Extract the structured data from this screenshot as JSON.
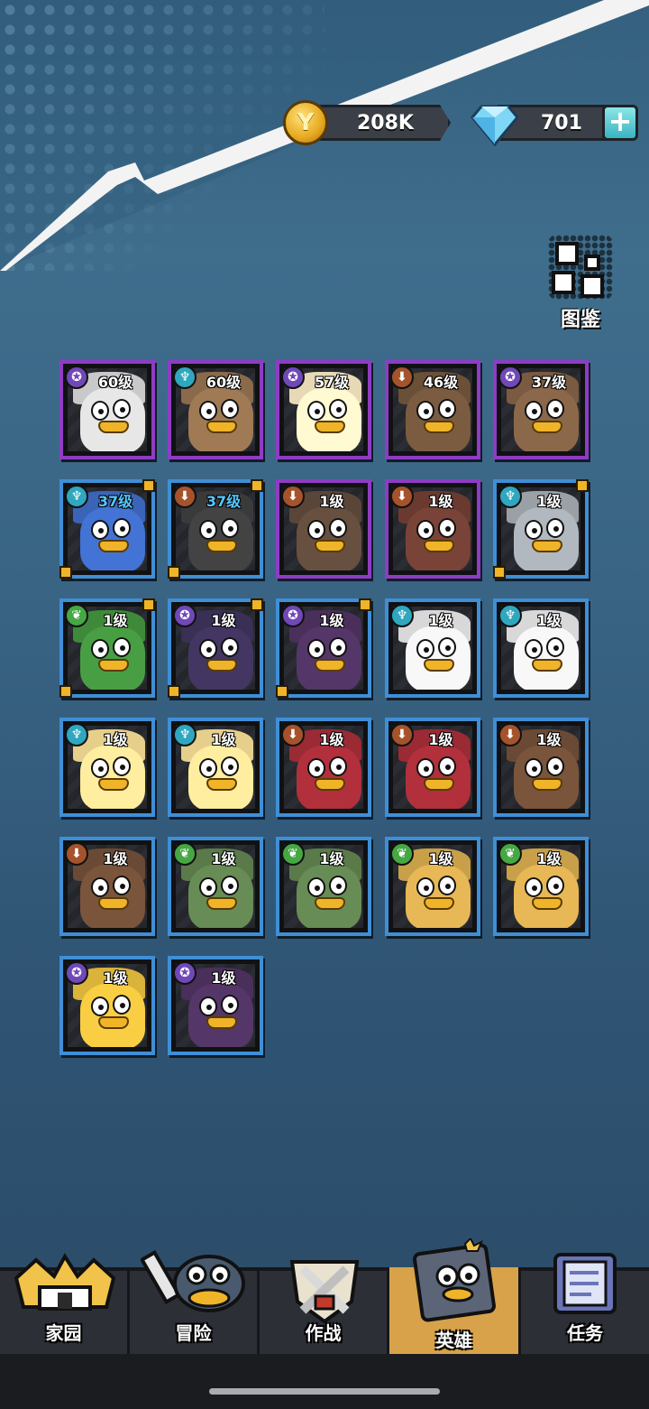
{
  "currency": {
    "coins": "208K",
    "gems": "701",
    "coin_icon": "coin-icon",
    "gem_icon": "diamond-icon",
    "plus_icon": "plus-icon"
  },
  "codex": {
    "label": "图鉴",
    "icon": "codex-grid-icon"
  },
  "heroes": [
    {
      "level": "60级",
      "faction": "purple",
      "frame": "purple"
    },
    {
      "level": "60级",
      "faction": "cyan",
      "frame": "purple"
    },
    {
      "level": "57级",
      "faction": "purple",
      "frame": "purple"
    },
    {
      "level": "46级",
      "faction": "brown",
      "frame": "purple"
    },
    {
      "level": "37级",
      "faction": "purple",
      "frame": "purple"
    },
    {
      "level": "37级",
      "faction": "cyan",
      "frame": "blue"
    },
    {
      "level": "37级",
      "faction": "brown",
      "frame": "blue"
    },
    {
      "level": "1级",
      "faction": "brown",
      "frame": "purple"
    },
    {
      "level": "1级",
      "faction": "brown",
      "frame": "purple"
    },
    {
      "level": "1级",
      "faction": "cyan",
      "frame": "blue"
    },
    {
      "level": "1级",
      "faction": "green",
      "frame": "blue"
    },
    {
      "level": "1级",
      "faction": "purple",
      "frame": "blue"
    },
    {
      "level": "1级",
      "faction": "purple",
      "frame": "blue"
    },
    {
      "level": "1级",
      "faction": "cyan",
      "frame": "blue"
    },
    {
      "level": "1级",
      "faction": "cyan",
      "frame": "blue"
    },
    {
      "level": "1级",
      "faction": "cyan",
      "frame": "blue"
    },
    {
      "level": "1级",
      "faction": "cyan",
      "frame": "blue"
    },
    {
      "level": "1级",
      "faction": "brown",
      "frame": "blue"
    },
    {
      "level": "1级",
      "faction": "brown",
      "frame": "blue"
    },
    {
      "level": "1级",
      "faction": "brown",
      "frame": "blue"
    },
    {
      "level": "1级",
      "faction": "brown",
      "frame": "blue"
    },
    {
      "level": "1级",
      "faction": "green",
      "frame": "blue"
    },
    {
      "level": "1级",
      "faction": "green",
      "frame": "blue"
    },
    {
      "level": "1级",
      "faction": "green",
      "frame": "blue"
    },
    {
      "level": "1级",
      "faction": "green",
      "frame": "blue"
    },
    {
      "level": "1级",
      "faction": "purple",
      "frame": "blue"
    },
    {
      "level": "1级",
      "faction": "purple",
      "frame": "blue"
    }
  ],
  "nav": [
    {
      "label": "家园",
      "icon": "castle-icon",
      "active": false
    },
    {
      "label": "冒险",
      "icon": "sword-duck-icon",
      "active": false
    },
    {
      "label": "作战",
      "icon": "crossed-swords-shield-icon",
      "active": false
    },
    {
      "label": "英雄",
      "icon": "hero-book-icon",
      "active": true
    },
    {
      "label": "任务",
      "icon": "scroll-icon",
      "active": false
    }
  ],
  "colors": {
    "frame_blue": "#3f8fd6",
    "frame_purple": "#8f3cc4",
    "active_tab": "#d8a24a",
    "level_blue_text": "#56c8ff"
  }
}
